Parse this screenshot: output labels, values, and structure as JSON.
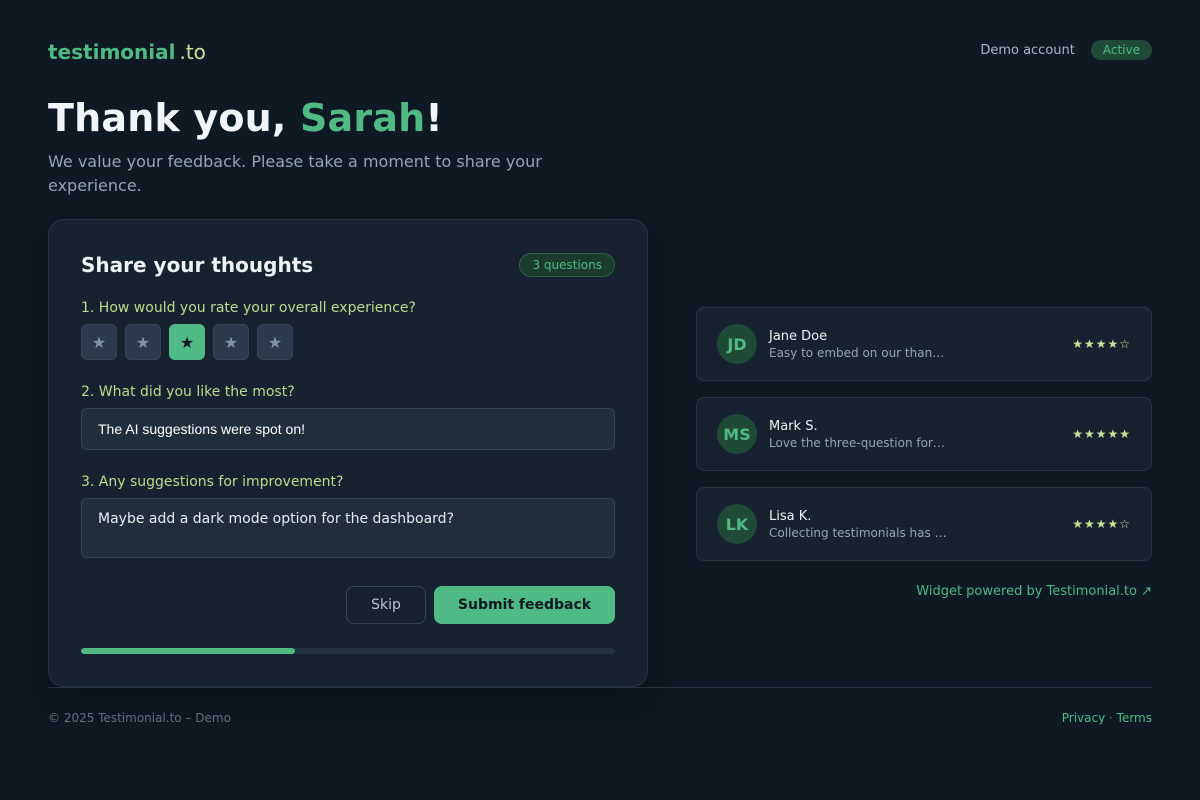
{
  "header": {
    "logo_main": "testimonial",
    "logo_tld": ".to",
    "account_label": "Demo account",
    "account_status": "Active"
  },
  "hero": {
    "greeting": "Thank you, ",
    "name": "Sarah",
    "exclamation": "!",
    "subtitle": "We value your feedback. Please take a moment to share your experience."
  },
  "form": {
    "title": "Share your thoughts",
    "questions_badge": "3 questions",
    "q1_label": "1. How would you rate your overall experience?",
    "rating_selected": 3,
    "rating_max": 5,
    "star_glyph": "★",
    "q2_label": "2. What did you like the most?",
    "q2_value": "The AI suggestions were spot on!",
    "q3_label": "3. Any suggestions for improvement?",
    "q3_value": "Maybe add a dark mode option for the dashboard?",
    "skip_label": "Skip",
    "submit_label": "Submit feedback",
    "progress_percent": 40
  },
  "testimonials": [
    {
      "initials": "JD",
      "name": "Jane Doe",
      "quote": "Easy to embed on our than…",
      "stars": "★★★★☆"
    },
    {
      "initials": "MS",
      "name": "Mark S.",
      "quote": "Love the three-question for…",
      "stars": "★★★★★"
    },
    {
      "initials": "LK",
      "name": "Lisa K.",
      "quote": "Collecting testimonials has …",
      "stars": "★★★★☆"
    }
  ],
  "widget_credit": "Widget powered by Testimonial.to ↗",
  "footer": {
    "copyright": "© 2025 Testimonial.to – Demo",
    "privacy": "Privacy",
    "separator": " · ",
    "terms": "Terms"
  },
  "colors": {
    "accent": "#4fba84",
    "background": "#0f1923",
    "card": "#16222f",
    "question_text": "#b9dd8e"
  }
}
